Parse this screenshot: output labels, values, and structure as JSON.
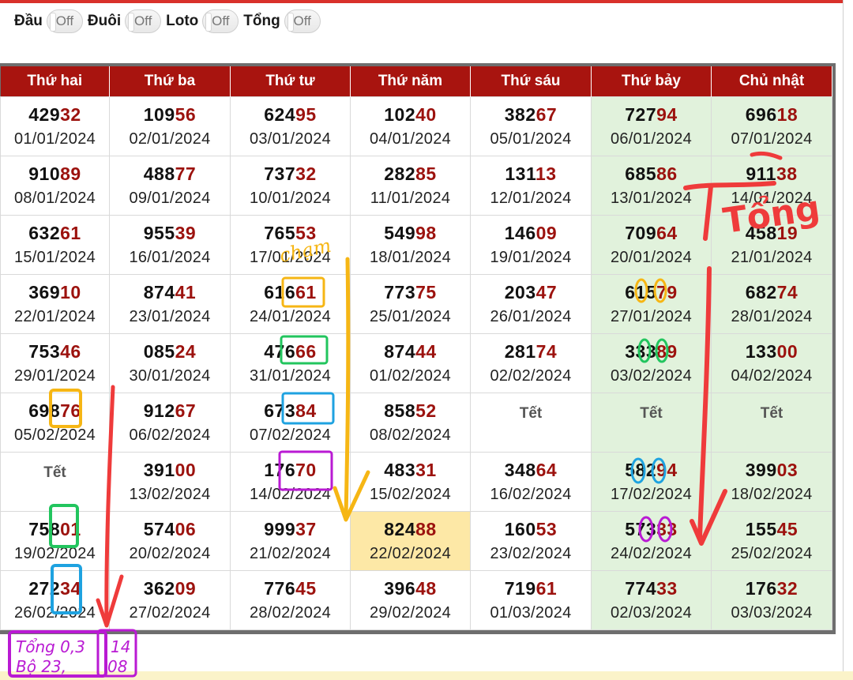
{
  "toggles": [
    {
      "label": "Đầu",
      "state": "Off"
    },
    {
      "label": "Đuôi",
      "state": "Off"
    },
    {
      "label": "Loto",
      "state": "Off"
    },
    {
      "label": "Tổng",
      "state": "Off"
    }
  ],
  "weekdays": [
    "Thứ hai",
    "Thứ ba",
    "Thứ tư",
    "Thứ năm",
    "Thứ sáu",
    "Thứ bảy",
    "Chủ nhật"
  ],
  "holiday_label": "Tết",
  "rows": [
    [
      {
        "head": "429",
        "tail": "32",
        "date": "01/01/2024"
      },
      {
        "head": "109",
        "tail": "56",
        "date": "02/01/2024"
      },
      {
        "head": "624",
        "tail": "95",
        "date": "03/01/2024"
      },
      {
        "head": "102",
        "tail": "40",
        "date": "04/01/2024"
      },
      {
        "head": "382",
        "tail": "67",
        "date": "05/01/2024"
      },
      {
        "head": "727",
        "tail": "94",
        "date": "06/01/2024"
      },
      {
        "head": "696",
        "tail": "18",
        "date": "07/01/2024"
      }
    ],
    [
      {
        "head": "910",
        "tail": "89",
        "date": "08/01/2024"
      },
      {
        "head": "488",
        "tail": "77",
        "date": "09/01/2024"
      },
      {
        "head": "737",
        "tail": "32",
        "date": "10/01/2024"
      },
      {
        "head": "282",
        "tail": "85",
        "date": "11/01/2024"
      },
      {
        "head": "131",
        "tail": "13",
        "date": "12/01/2024"
      },
      {
        "head": "685",
        "tail": "86",
        "date": "13/01/2024"
      },
      {
        "head": "911",
        "tail": "38",
        "date": "14/01/2024"
      }
    ],
    [
      {
        "head": "632",
        "tail": "61",
        "date": "15/01/2024"
      },
      {
        "head": "955",
        "tail": "39",
        "date": "16/01/2024"
      },
      {
        "head": "765",
        "tail": "53",
        "date": "17/01/2024"
      },
      {
        "head": "549",
        "tail": "98",
        "date": "18/01/2024"
      },
      {
        "head": "146",
        "tail": "09",
        "date": "19/01/2024"
      },
      {
        "head": "709",
        "tail": "64",
        "date": "20/01/2024"
      },
      {
        "head": "458",
        "tail": "19",
        "date": "21/01/2024"
      }
    ],
    [
      {
        "head": "369",
        "tail": "10",
        "date": "22/01/2024"
      },
      {
        "head": "874",
        "tail": "41",
        "date": "23/01/2024"
      },
      {
        "head": "616",
        "tail": "61",
        "date": "24/01/2024"
      },
      {
        "head": "773",
        "tail": "75",
        "date": "25/01/2024"
      },
      {
        "head": "203",
        "tail": "47",
        "date": "26/01/2024"
      },
      {
        "head": "615",
        "tail": "79",
        "date": "27/01/2024"
      },
      {
        "head": "682",
        "tail": "74",
        "date": "28/01/2024"
      }
    ],
    [
      {
        "head": "753",
        "tail": "46",
        "date": "29/01/2024"
      },
      {
        "head": "085",
        "tail": "24",
        "date": "30/01/2024"
      },
      {
        "head": "476",
        "tail": "66",
        "date": "31/01/2024"
      },
      {
        "head": "874",
        "tail": "44",
        "date": "01/02/2024"
      },
      {
        "head": "281",
        "tail": "74",
        "date": "02/02/2024"
      },
      {
        "head": "333",
        "tail": "89",
        "date": "03/02/2024"
      },
      {
        "head": "133",
        "tail": "00",
        "date": "04/02/2024"
      }
    ],
    [
      {
        "head": "698",
        "tail": "76",
        "date": "05/02/2024"
      },
      {
        "head": "912",
        "tail": "67",
        "date": "06/02/2024"
      },
      {
        "head": "673",
        "tail": "84",
        "date": "07/02/2024"
      },
      {
        "head": "858",
        "tail": "52",
        "date": "08/02/2024"
      },
      {
        "tet": true
      },
      {
        "tet": true
      },
      {
        "tet": true
      }
    ],
    [
      {
        "tet": true
      },
      {
        "head": "391",
        "tail": "00",
        "date": "13/02/2024"
      },
      {
        "head": "176",
        "tail": "70",
        "date": "14/02/2024"
      },
      {
        "head": "483",
        "tail": "31",
        "date": "15/02/2024"
      },
      {
        "head": "348",
        "tail": "64",
        "date": "16/02/2024"
      },
      {
        "head": "582",
        "tail": "94",
        "date": "17/02/2024"
      },
      {
        "head": "399",
        "tail": "03",
        "date": "18/02/2024"
      }
    ],
    [
      {
        "head": "758",
        "tail": "01",
        "date": "19/02/2024"
      },
      {
        "head": "574",
        "tail": "06",
        "date": "20/02/2024"
      },
      {
        "head": "999",
        "tail": "37",
        "date": "21/02/2024"
      },
      {
        "head": "824",
        "tail": "88",
        "date": "22/02/2024",
        "highlight": true
      },
      {
        "head": "160",
        "tail": "53",
        "date": "23/02/2024"
      },
      {
        "head": "573",
        "tail": "33",
        "date": "24/02/2024"
      },
      {
        "head": "155",
        "tail": "45",
        "date": "25/02/2024"
      }
    ],
    [
      {
        "head": "272",
        "tail": "34",
        "date": "26/02/2024"
      },
      {
        "head": "362",
        "tail": "09",
        "date": "27/02/2024"
      },
      {
        "head": "776",
        "tail": "45",
        "date": "28/02/2024"
      },
      {
        "head": "396",
        "tail": "48",
        "date": "29/02/2024"
      },
      {
        "head": "719",
        "tail": "61",
        "date": "01/03/2024"
      },
      {
        "head": "774",
        "tail": "33",
        "date": "02/03/2024"
      },
      {
        "head": "176",
        "tail": "32",
        "date": "03/03/2024"
      }
    ]
  ],
  "annotations": {
    "tong": "Tổng",
    "cham": "chạm",
    "note_lines": [
      "Tổng 0,3",
      "Bộ 23,"
    ],
    "note_extra": [
      "14",
      "08"
    ]
  },
  "colors": {
    "header_red": "#a8140f",
    "number_tail": "#9c120e",
    "weekend_green": "#e1f2dc",
    "highlight": "#fde8a6",
    "ink_red": "#ef3b3b",
    "ink_orange": "#f6b614",
    "ink_green": "#22c55e",
    "ink_blue": "#1ea2e0",
    "ink_purple": "#b91ad3"
  }
}
